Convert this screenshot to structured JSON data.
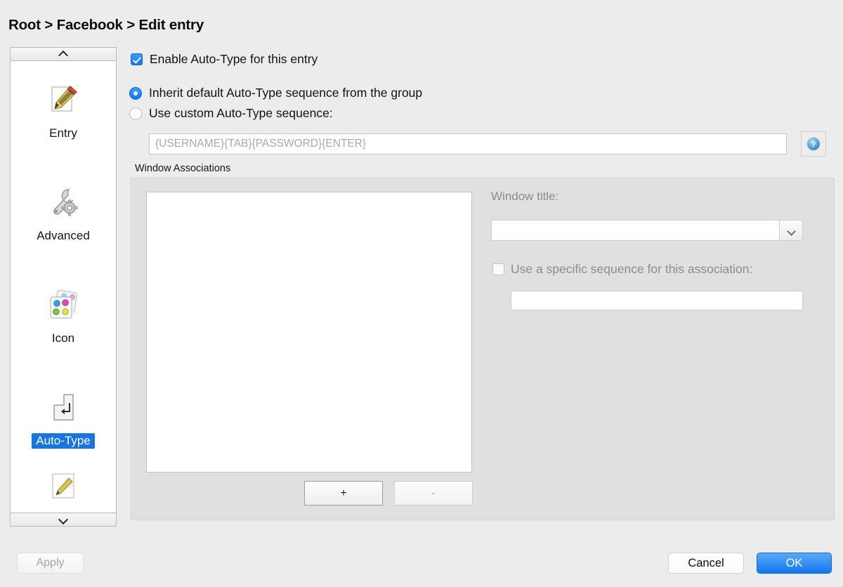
{
  "breadcrumb": "Root > Facebook > Edit entry",
  "sidebar": {
    "scroll_up_icon": "chevron-up-icon",
    "scroll_down_icon": "chevron-down-icon",
    "items": [
      {
        "label": "Entry",
        "icon": "pencil-document-icon",
        "selected": false
      },
      {
        "label": "Advanced",
        "icon": "wrench-gear-icon",
        "selected": false
      },
      {
        "label": "Icon",
        "icon": "color-palette-icon",
        "selected": false
      },
      {
        "label": "Auto-Type",
        "icon": "keyboard-return-icon",
        "selected": true
      },
      {
        "label": "",
        "icon": "pencil-icon",
        "selected": false
      }
    ]
  },
  "autotype": {
    "enable_label": "Enable Auto-Type for this entry",
    "enable_checked": true,
    "inherit_label": "Inherit default Auto-Type sequence from the group",
    "inherit_selected": true,
    "custom_label": "Use custom Auto-Type sequence:",
    "custom_selected": false,
    "sequence_value": "{USERNAME}{TAB}{PASSWORD}{ENTER}",
    "help_icon": "help-question-icon"
  },
  "window_associations": {
    "group_title": "Window Associations",
    "list_items": [],
    "add_label": "+",
    "remove_label": "-",
    "window_title_label": "Window title:",
    "window_title_value": "",
    "dropdown_icon": "chevron-down-icon",
    "specific_sequence_label": "Use a specific sequence for this association:",
    "specific_sequence_checked": false,
    "specific_sequence_value": ""
  },
  "footer": {
    "apply_label": "Apply",
    "cancel_label": "Cancel",
    "ok_label": "OK"
  },
  "colors": {
    "accent_blue": "#1675e0",
    "window_bg": "#ececec",
    "panel_bg": "#e0e0e0",
    "field_bg": "#ffffff",
    "disabled_text": "#8c8c8c"
  }
}
